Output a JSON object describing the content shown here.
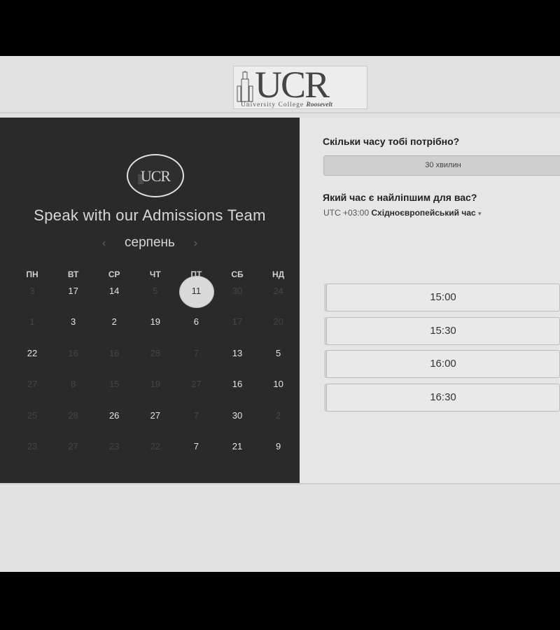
{
  "header": {
    "logo_text": "UCR",
    "logo_subtitle": "University College",
    "logo_subtitle_script": "Roosevelt"
  },
  "calendar": {
    "badge_text": "UCR",
    "title": "Speak with our Admissions Team",
    "month": "серпень",
    "prev_icon": "‹",
    "next_icon": "›",
    "weekdays": [
      "ПН",
      "ВТ",
      "СР",
      "ЧТ",
      "ПТ",
      "СБ",
      "НД"
    ],
    "rows": [
      [
        {
          "d": "3",
          "s": "off"
        },
        {
          "d": "17",
          "s": "on"
        },
        {
          "d": "14",
          "s": "on"
        },
        {
          "d": "5",
          "s": "off"
        },
        {
          "d": "11",
          "s": "sel"
        },
        {
          "d": "30",
          "s": "off"
        },
        {
          "d": "24",
          "s": "off"
        }
      ],
      [
        {
          "d": "1",
          "s": "off"
        },
        {
          "d": "3",
          "s": "on"
        },
        {
          "d": "2",
          "s": "on"
        },
        {
          "d": "19",
          "s": "on"
        },
        {
          "d": "6",
          "s": "on"
        },
        {
          "d": "17",
          "s": "off"
        },
        {
          "d": "20",
          "s": "off"
        }
      ],
      [
        {
          "d": "22",
          "s": "on"
        },
        {
          "d": "16",
          "s": "off"
        },
        {
          "d": "16",
          "s": "off"
        },
        {
          "d": "28",
          "s": "off"
        },
        {
          "d": "7",
          "s": "off"
        },
        {
          "d": "13",
          "s": "on"
        },
        {
          "d": "5",
          "s": "on"
        }
      ],
      [
        {
          "d": "27",
          "s": "off"
        },
        {
          "d": "8",
          "s": "off"
        },
        {
          "d": "15",
          "s": "off"
        },
        {
          "d": "19",
          "s": "off"
        },
        {
          "d": "27",
          "s": "off"
        },
        {
          "d": "16",
          "s": "on"
        },
        {
          "d": "10",
          "s": "on"
        }
      ],
      [
        {
          "d": "25",
          "s": "off"
        },
        {
          "d": "28",
          "s": "off"
        },
        {
          "d": "26",
          "s": "on"
        },
        {
          "d": "27",
          "s": "on"
        },
        {
          "d": "7",
          "s": "off"
        },
        {
          "d": "30",
          "s": "on"
        },
        {
          "d": "2",
          "s": "off"
        }
      ],
      [
        {
          "d": "23",
          "s": "off"
        },
        {
          "d": "27",
          "s": "off"
        },
        {
          "d": "23",
          "s": "off"
        },
        {
          "d": "22",
          "s": "off"
        },
        {
          "d": "7",
          "s": "on"
        },
        {
          "d": "21",
          "s": "on"
        },
        {
          "d": "9",
          "s": "on"
        }
      ]
    ]
  },
  "booking": {
    "duration_question": "Скільки часу тобі потрібно?",
    "duration_value": "30 хвилин",
    "time_question": "Який час є найліпшим для вас?",
    "timezone_code": "UTC +03:00",
    "timezone_name": "Східноєвропейський час",
    "timezone_caret": "▾",
    "slots": [
      "15:00",
      "15:30",
      "16:00",
      "16:30"
    ]
  }
}
